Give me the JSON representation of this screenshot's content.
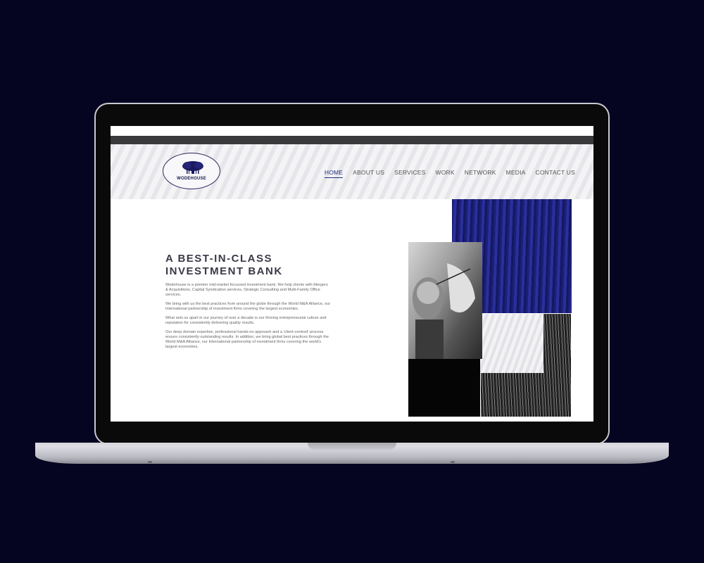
{
  "header": {
    "logo_text": "WODEHOUSE",
    "nav": [
      "HOME",
      "ABOUT US",
      "SERVICES",
      "WORK",
      "NETWORK",
      "MEDIA",
      "CONTACT US"
    ],
    "active_nav": "HOME"
  },
  "main": {
    "headline_line1": "A BEST-IN-CLASS",
    "headline_line2": "INVESTMENT BANK",
    "paragraphs": [
      "Wodehouse is a premier mid-market focussed investment bank. We help clients with Mergers & Acquisitions, Capital Syndication services, Strategic Consulting and Multi-Family Office services.",
      "We bring with us the best practices from around the globe through the World M&A Alliance, our International partnership of investment firms covering the largest economies.",
      "What sets us apart in our journey of over a decade is our thriving entrepreneurial culture and reputation for consistently delivering quality results.",
      "Our deep domain expertise, professional hands-on approach and a 'client-centred' process ensure consistently outstanding results. In addition, we bring global best practices through the World M&A Alliance, our International partnership of investment firms covering the world's largest economies."
    ]
  },
  "colors": {
    "background": "#050522",
    "accent": "#1f2b7a",
    "heading": "#3a3a48"
  }
}
